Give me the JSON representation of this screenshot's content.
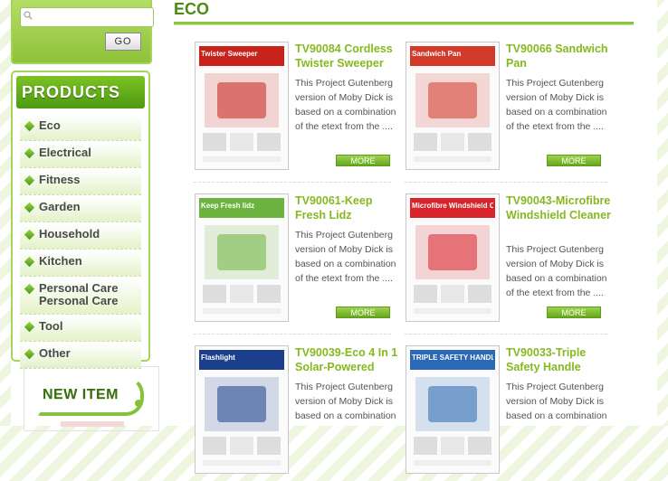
{
  "search": {
    "placeholder": "",
    "go_label": "GO"
  },
  "sidebar": {
    "products_heading": "PRODUCTS",
    "categories": [
      "Eco",
      "Electrical",
      "Fitness",
      "Garden",
      "Household",
      "Kitchen",
      "Personal Care Personal Care",
      "Tool",
      "Other"
    ],
    "new_item_label": "NEW ITEM"
  },
  "main": {
    "title": "ECO",
    "more_label": "MORE",
    "products": [
      {
        "title": "TV90084 Cordless Twister Sweeper",
        "desc": "This Project Gutenberg version of Moby Dick is based on a combination of the etext from the ....",
        "thumb_text": "Twister Sweeper",
        "thumb_color": "#c7231b"
      },
      {
        "title": "TV90066 Sandwich Pan",
        "desc": "This Project Gutenberg version of Moby Dick is based on a combination of the etext from the ....",
        "thumb_text": "Sandwich Pan",
        "thumb_color": "#d33a2a"
      },
      {
        "title": "TV90061-Keep Fresh Lidz",
        "desc": "This Project Gutenberg version of Moby Dick is based on a combination of the etext from the ....",
        "thumb_text": "Keep Fresh lidz",
        "thumb_color": "#6db33f"
      },
      {
        "title": "TV90043-Microfibre Windshield Cleaner",
        "desc": "This Project Gutenberg version of Moby Dick is based on a combination of the etext from the ....",
        "thumb_text": "Microfibre Windshield Cleaner",
        "thumb_color": "#d8242a"
      },
      {
        "title": "TV90039-Eco 4 In 1 Solar-Powered",
        "desc": "This Project Gutenberg version of Moby Dick is based on a combination",
        "thumb_text": "Flashlight",
        "thumb_color": "#1b3f8c"
      },
      {
        "title": "TV90033-Triple Safety Handle",
        "desc": "This Project Gutenberg version of Moby Dick is based on a combination",
        "thumb_text": "TRIPLE SAFETY HANDLE",
        "thumb_color": "#2b68b5"
      }
    ]
  },
  "colors": {
    "accent": "#86b81f",
    "brand_green": "#4c8a10"
  }
}
